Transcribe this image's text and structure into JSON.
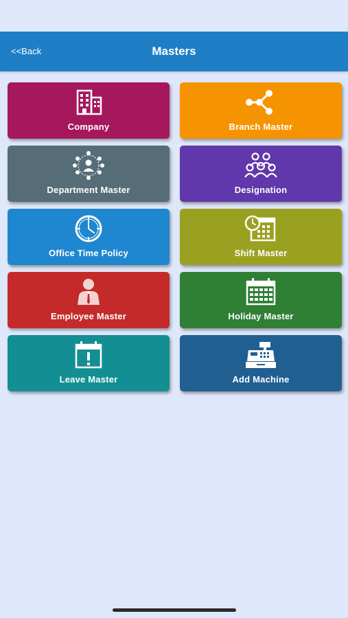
{
  "header": {
    "back_label": "<<Back",
    "title": "Masters"
  },
  "tiles": [
    {
      "label": "Company",
      "color": "#a6185d",
      "icon": "building-icon"
    },
    {
      "label": "Branch Master",
      "color": "#f69300",
      "icon": "branch-network-icon"
    },
    {
      "label": "Department Master",
      "color": "#566d78",
      "icon": "department-network-icon"
    },
    {
      "label": "Designation",
      "color": "#6038ac",
      "icon": "group-people-icon"
    },
    {
      "label": "Office Time Policy",
      "color": "#1f87cf",
      "icon": "clock-icon"
    },
    {
      "label": "Shift Master",
      "color": "#9aa121",
      "icon": "calendar-clock-icon"
    },
    {
      "label": "Employee Master",
      "color": "#c42a2a",
      "icon": "employee-icon"
    },
    {
      "label": "Holiday Master",
      "color": "#2f7f34",
      "icon": "calendar-grid-icon"
    },
    {
      "label": "Leave Master",
      "color": "#138f93",
      "icon": "calendar-alert-icon"
    },
    {
      "label": "Add Machine",
      "color": "#215f91",
      "icon": "cash-register-icon"
    }
  ]
}
